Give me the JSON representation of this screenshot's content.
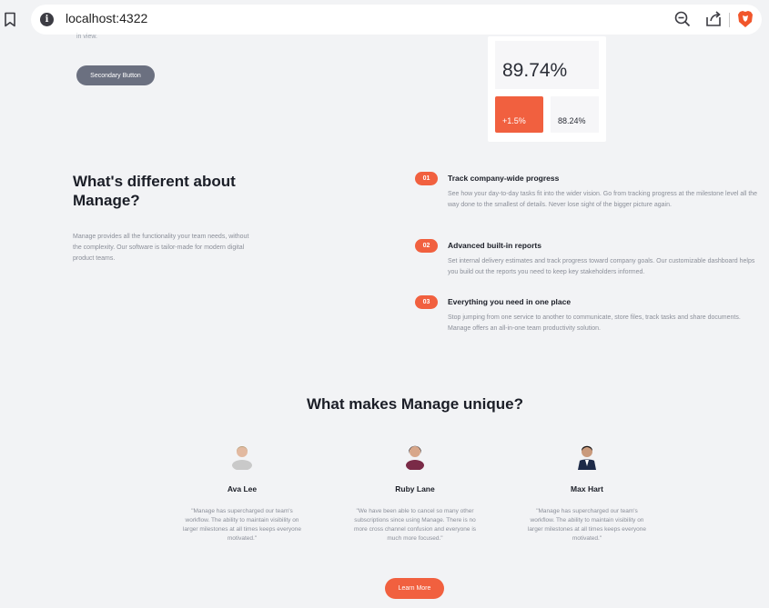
{
  "browser": {
    "url": "localhost:4322",
    "icons": [
      "bookmark-icon",
      "info-icon",
      "zoom-out-icon",
      "share-icon",
      "brave-icon"
    ]
  },
  "hero": {
    "cut_text": "in view.",
    "secondary_button": "Secondary Button",
    "stat_main": "89.74%",
    "stat_change": "+1.5%",
    "stat_secondary": "88.24%"
  },
  "different": {
    "title": "What's different about Manage?",
    "description": "Manage provides all the functionality your team needs, without the complexity. Our software is tailor-made for modern digital product teams.",
    "features": [
      {
        "number": "01",
        "title": "Track company-wide progress",
        "description": "See how your day-to-day tasks fit into the wider vision. Go from tracking progress at the milestone level all the way done to the smallest of details. Never lose sight of the bigger picture again."
      },
      {
        "number": "02",
        "title": "Advanced built-in reports",
        "description": "Set internal delivery estimates and track progress toward company goals. Our customizable dashboard helps you build out the reports you need to keep key stakeholders informed."
      },
      {
        "number": "03",
        "title": "Everything you need in one place",
        "description": "Stop jumping from one service to another to communicate, store files, track tasks and share documents. Manage offers an all-in-one team productivity solution."
      }
    ]
  },
  "unique": {
    "title": "What makes Manage unique?",
    "testimonials": [
      {
        "name": "Ava Lee",
        "quote": "\"Manage has supercharged our team's workflow. The ability to maintain visibility on larger milestones at all times keeps everyone motivated.\""
      },
      {
        "name": "Ruby Lane",
        "quote": "\"We have been able to cancel so many other subscriptions since using Manage. There is no more cross channel confusion and everyone is much more focused.\""
      },
      {
        "name": "Max Hart",
        "quote": "\"Manage has supercharged our team's workflow. The ability to maintain visibility on larger milestones at all times keeps everyone motivated.\""
      }
    ],
    "learn_more": "Learn More"
  },
  "colors": {
    "accent": "#f1603f",
    "secondary_button": "#6b7080",
    "background": "#f2f3f5",
    "heading": "#1b1e27",
    "muted_text": "#8b8f99"
  }
}
